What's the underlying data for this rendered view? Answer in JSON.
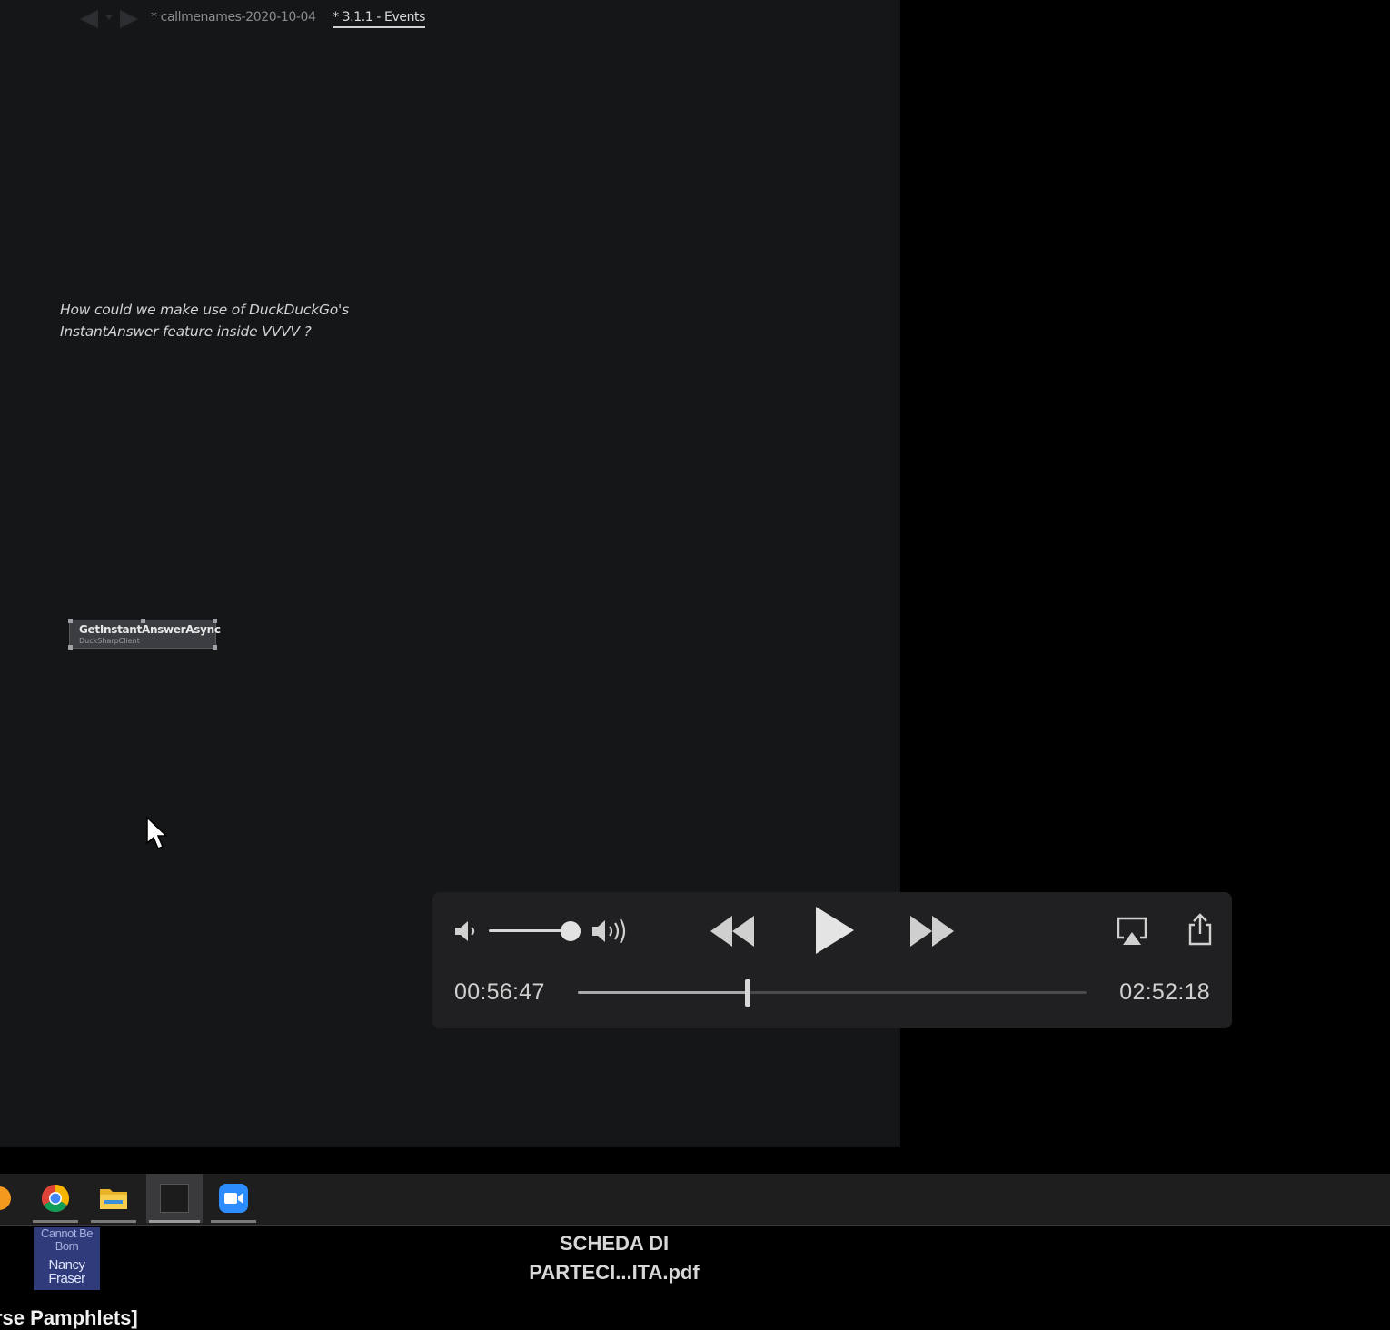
{
  "editor": {
    "tabs": [
      {
        "label": "* callmenames-2020-10-04",
        "active": false
      },
      {
        "label": "* 3.1.1 - Events",
        "active": true
      }
    ],
    "comment_lines": [
      "How could we make use of DuckDuckGo's",
      "InstantAnswer feature inside VVVV ?"
    ],
    "node": {
      "title": "GetInstantAnswerAsync",
      "subtitle": "DuckSharpClient"
    },
    "icons": {
      "back": "back-arrow-icon",
      "dropdown": "history-dropdown-icon",
      "forward": "forward-arrow-icon",
      "cursor": "mouse-cursor-icon"
    }
  },
  "player": {
    "time_elapsed": "00:56:47",
    "time_remaining": "02:52:18",
    "progress": 0.3336,
    "volume": 1.0,
    "icons": {
      "mute": "volume-low-icon",
      "volume_max": "volume-high-icon",
      "rewind": "rewind-icon",
      "play": "play-icon",
      "fast_forward": "fast-forward-icon",
      "airplay": "airplay-icon",
      "share": "share-icon"
    }
  },
  "taskbar": {
    "apps": [
      {
        "name": "firefox-icon",
        "active": false
      },
      {
        "name": "chrome-icon",
        "active": false
      },
      {
        "name": "file-explorer-icon",
        "active": false
      },
      {
        "name": "vvvv-icon",
        "active": true
      },
      {
        "name": "zoom-icon",
        "active": false
      }
    ]
  },
  "desktop": {
    "thumbnail": {
      "text_top": "Cannot Be Born",
      "text_author": "Nancy Fraser"
    },
    "file_label": [
      "SCHEDA DI",
      "PARTECI...ITA.pdf"
    ],
    "partial_label": "rse Pamphlets]"
  },
  "colors": {
    "editor_bg": "#151618",
    "player_bg": "#202022",
    "taskbar_bg": "#1e1e1f",
    "thumbnail_bg": "#2f3b7a"
  }
}
